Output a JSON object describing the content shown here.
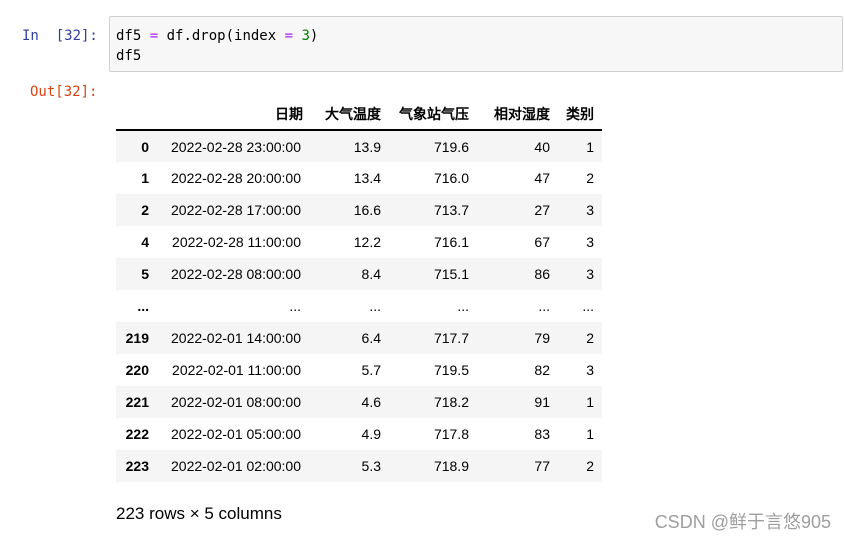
{
  "input_cell": {
    "prompt": "In  [32]:",
    "code_line1": {
      "a": "df5 ",
      "op1": "=",
      "b": " df.drop(index ",
      "op2": "=",
      "c": " ",
      "num": "3",
      "d": ")"
    },
    "code_line2": "df5"
  },
  "output_cell": {
    "prompt": "Out[32]:",
    "columns": [
      "日期",
      "大气温度",
      "气象站气压",
      "相对湿度",
      "类别"
    ],
    "rows": [
      {
        "idx": "0",
        "cells": [
          "2022-02-28 23:00:00",
          "13.9",
          "719.6",
          "40",
          "1"
        ]
      },
      {
        "idx": "1",
        "cells": [
          "2022-02-28 20:00:00",
          "13.4",
          "716.0",
          "47",
          "2"
        ]
      },
      {
        "idx": "2",
        "cells": [
          "2022-02-28 17:00:00",
          "16.6",
          "713.7",
          "27",
          "3"
        ]
      },
      {
        "idx": "4",
        "cells": [
          "2022-02-28 11:00:00",
          "12.2",
          "716.1",
          "67",
          "3"
        ]
      },
      {
        "idx": "5",
        "cells": [
          "2022-02-28 08:00:00",
          "8.4",
          "715.1",
          "86",
          "3"
        ]
      },
      {
        "idx": "...",
        "cells": [
          "...",
          "...",
          "...",
          "...",
          "..."
        ]
      },
      {
        "idx": "219",
        "cells": [
          "2022-02-01 14:00:00",
          "6.4",
          "717.7",
          "79",
          "2"
        ]
      },
      {
        "idx": "220",
        "cells": [
          "2022-02-01 11:00:00",
          "5.7",
          "719.5",
          "82",
          "3"
        ]
      },
      {
        "idx": "221",
        "cells": [
          "2022-02-01 08:00:00",
          "4.6",
          "718.2",
          "91",
          "1"
        ]
      },
      {
        "idx": "222",
        "cells": [
          "2022-02-01 05:00:00",
          "4.9",
          "717.8",
          "83",
          "1"
        ]
      },
      {
        "idx": "223",
        "cells": [
          "2022-02-01 02:00:00",
          "5.3",
          "718.9",
          "77",
          "2"
        ]
      }
    ],
    "summary": "223 rows × 5 columns"
  },
  "watermark": "CSDN @鲜于言悠905",
  "colors": {
    "in_prompt": "#303f9f",
    "out_prompt": "#d84315",
    "code_bg": "#f7f7f7",
    "operator": "#aa22ff",
    "number": "#008000",
    "row_stripe": "#f5f5f5"
  }
}
